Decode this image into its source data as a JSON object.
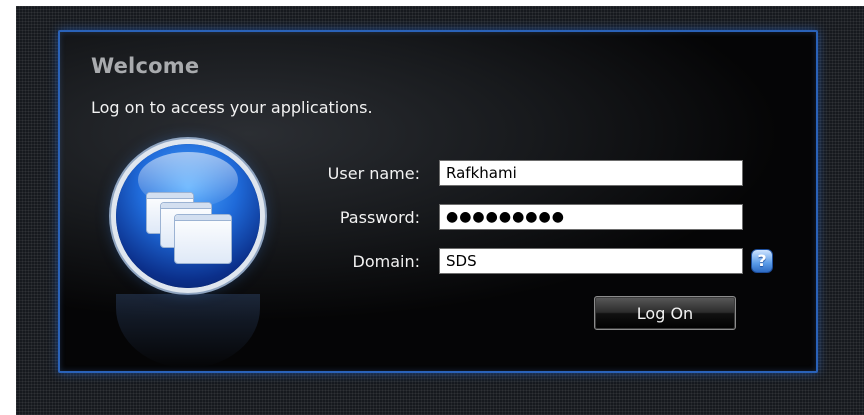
{
  "dialog": {
    "title": "Welcome",
    "subtitle": "Log on to access your applications."
  },
  "form": {
    "username_label": "User name:",
    "username_value": "Rafkhami",
    "password_label": "Password:",
    "password_value": "●●●●●●●●●",
    "domain_label": "Domain:",
    "domain_value": "SDS",
    "help_icon_glyph": "?",
    "logon_label": "Log On"
  },
  "icons": {
    "app_icon": "windows-globe-icon",
    "help_icon": "question-mark-icon"
  },
  "colors": {
    "panel_border": "#2a62b8",
    "title": "#a9abae",
    "text": "#f2f2f2",
    "globe_blue": "#1f6ad9"
  }
}
